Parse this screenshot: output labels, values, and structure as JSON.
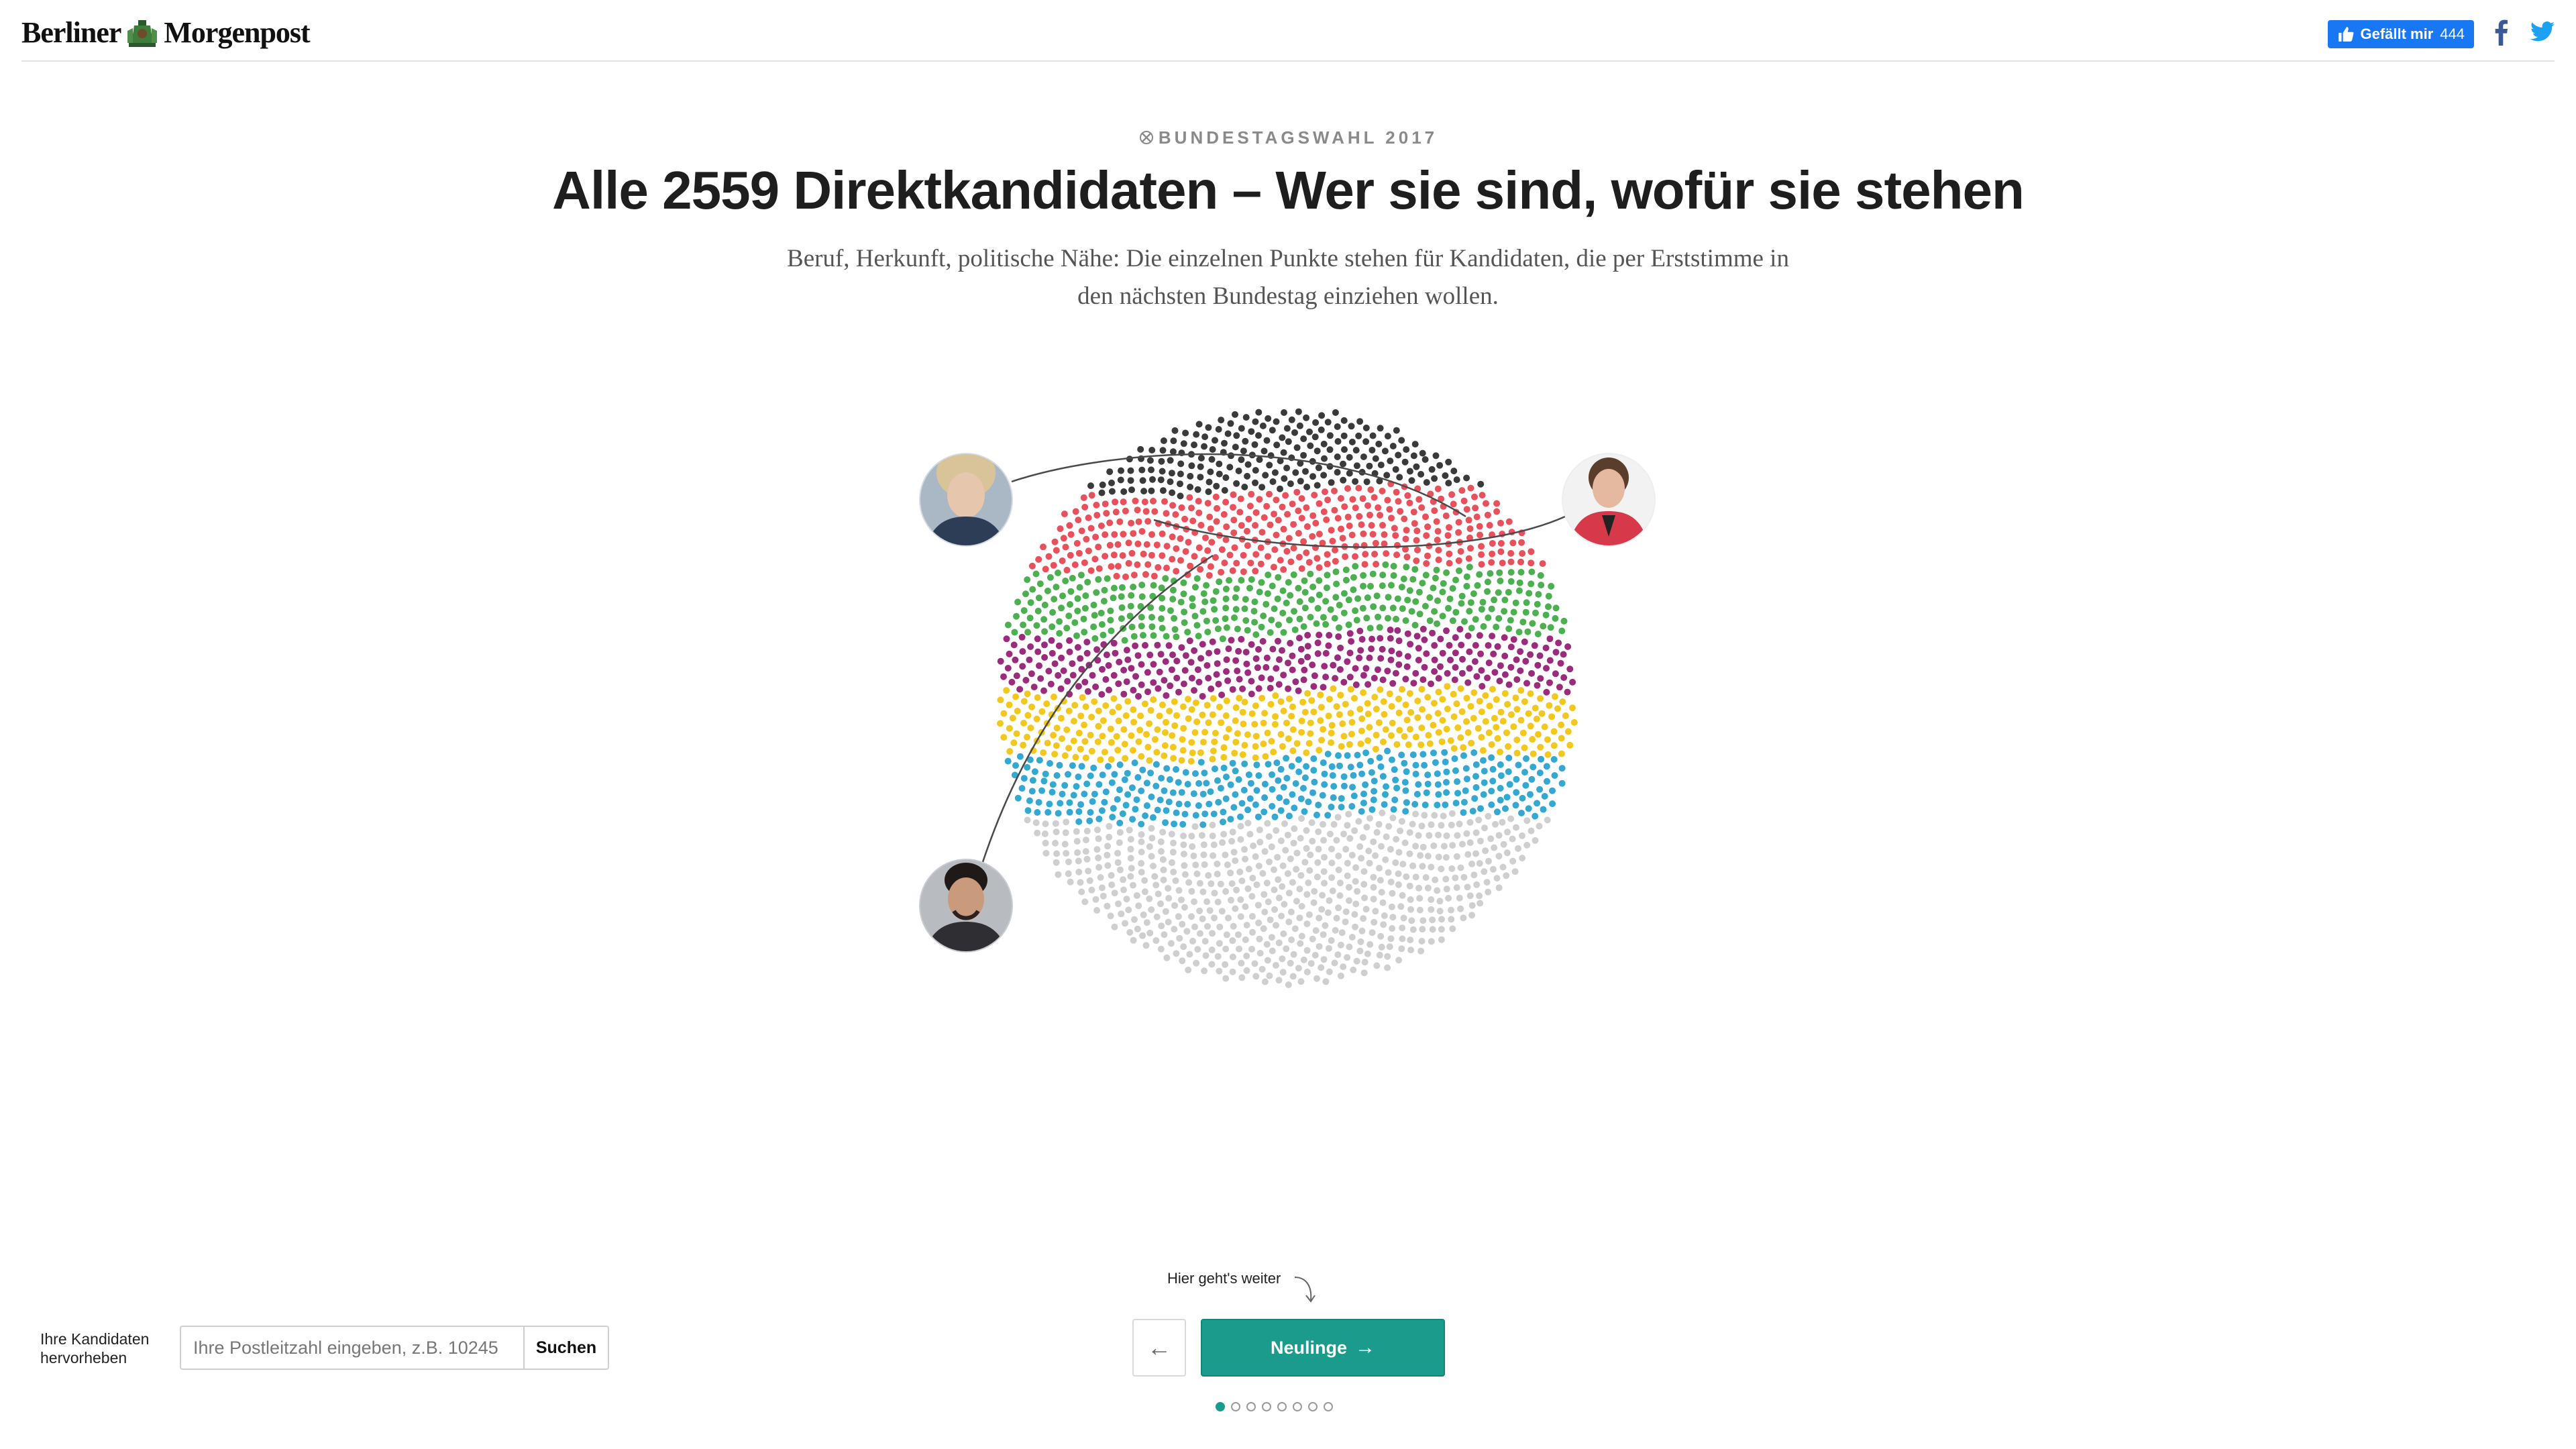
{
  "header": {
    "logo_left": "Berliner",
    "logo_right": "Morgenpost",
    "fb_like_label": "Gefällt mir",
    "fb_like_count": "444"
  },
  "article": {
    "kicker": "BUNDESTAGSWAHL 2017",
    "title": "Alle 2559 Direktkandidaten – Wer sie sind, wofür sie stehen",
    "subtitle_line1": "Beruf, Herkunft, politische Nähe: Die einzelnen Punkte stehen für Kandidaten, die per Erststimme in",
    "subtitle_line2": "den nächsten Bundestag einziehen wollen."
  },
  "chart_data": {
    "type": "scatter",
    "total_points": 2559,
    "bands": [
      {
        "color": "#3a3a3a"
      },
      {
        "color": "#e8505b"
      },
      {
        "color": "#4caf50"
      },
      {
        "color": "#9b2c7c"
      },
      {
        "color": "#f2c81e"
      },
      {
        "color": "#35a8d2"
      },
      {
        "color": "#cfcfcf"
      }
    ]
  },
  "navigation": {
    "hint": "Hier geht's weiter",
    "prev_symbol": "←",
    "next_label": "Neulinge",
    "next_symbol": "→",
    "step_count": 8,
    "active_step": 1
  },
  "search": {
    "label_line1": "Ihre Kandidaten",
    "label_line2": "hervorheben",
    "placeholder": "Ihre Postleitzahl eingeben, z.B. 10245",
    "button_label": "Suchen"
  },
  "colors": {
    "accent": "#1a9b8c",
    "facebook": "#1877f2",
    "twitter": "#1da1f2"
  }
}
